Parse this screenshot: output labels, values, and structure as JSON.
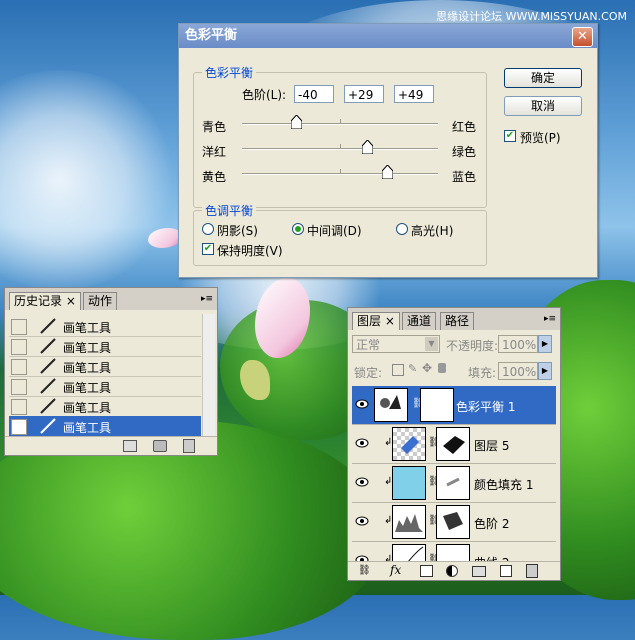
{
  "watermark": "思缘设计论坛 WWW.MISSYUAN.COM",
  "color_balance": {
    "title": "色彩平衡",
    "close": "✕",
    "group_title": "色彩平衡",
    "levels_label": "色阶(L):",
    "levels": [
      "-40",
      "+29",
      "+49"
    ],
    "sliders": [
      {
        "left": "青色",
        "right": "红色",
        "value": -40
      },
      {
        "left": "洋红",
        "right": "绿色",
        "value": 29
      },
      {
        "left": "黄色",
        "right": "蓝色",
        "value": 49
      }
    ],
    "ok": "确定",
    "cancel": "取消",
    "preview": "预览(P)",
    "preview_checked": true,
    "tone_title": "色调平衡",
    "tones": [
      "阴影(S)",
      "中间调(D)",
      "高光(H)"
    ],
    "selected_tone": "中间调(D)",
    "preserve": "保持明度(V)",
    "preserve_checked": true
  },
  "history": {
    "tabs": [
      "历史记录",
      "动作"
    ],
    "tab_close": "×",
    "items": [
      "画笔工具",
      "画笔工具",
      "画笔工具",
      "画笔工具",
      "画笔工具",
      "画笔工具"
    ],
    "selected_index": 5
  },
  "layers": {
    "tabs": [
      "图层",
      "通道",
      "路径"
    ],
    "tab_close": "×",
    "blend_mode": "正常",
    "opacity_label": "不透明度:",
    "opacity": "100%",
    "lock_label": "锁定:",
    "fill_label": "填充:",
    "fill": "100%",
    "rows": [
      "色彩平衡 1",
      "图层 5",
      "颜色填充 1",
      "色阶 2",
      "曲线 2"
    ],
    "selected_index": 0,
    "footer_icons": [
      "link-icon",
      "fx-icon",
      "mask-icon",
      "adjustment-icon",
      "folder-icon",
      "new-layer-icon",
      "trash-icon"
    ],
    "footer_fx": "fx"
  },
  "accent": "#316ac5"
}
